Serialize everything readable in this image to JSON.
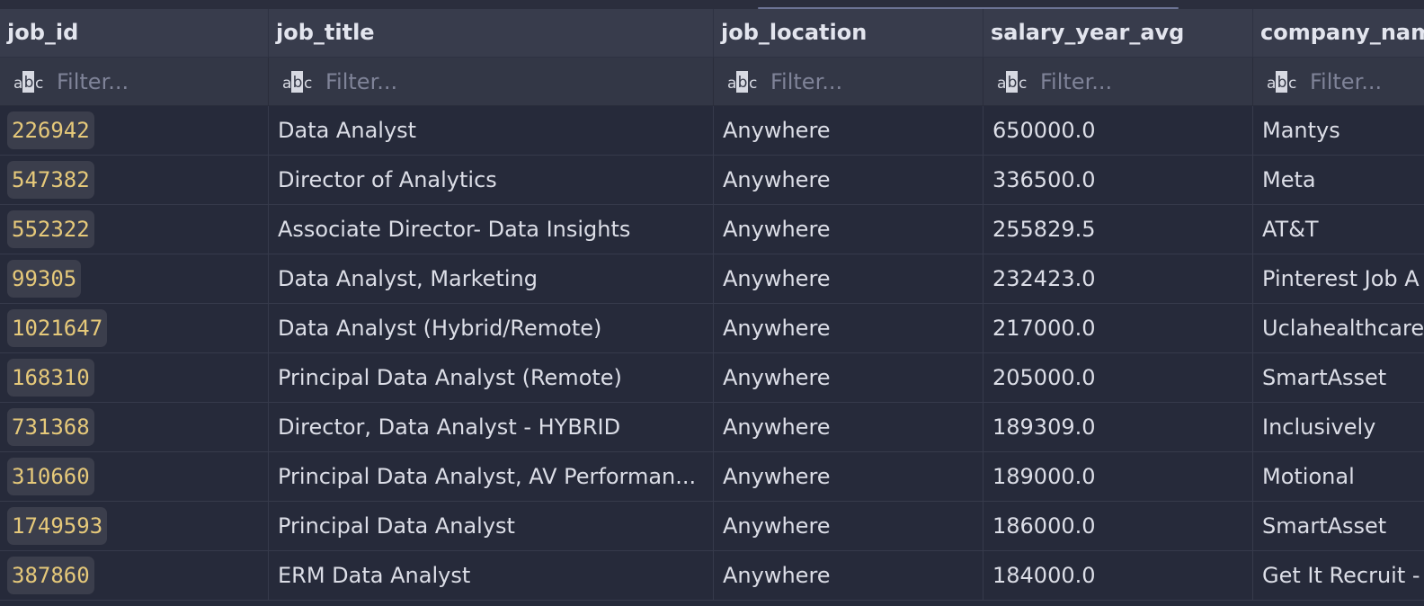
{
  "table": {
    "columns": [
      {
        "key": "job_id",
        "label": "job_id"
      },
      {
        "key": "job_title",
        "label": "job_title"
      },
      {
        "key": "job_location",
        "label": "job_location"
      },
      {
        "key": "salary_year_avg",
        "label": "salary_year_avg"
      },
      {
        "key": "company_name",
        "label": "company_nam"
      }
    ],
    "filter": {
      "placeholder": "Filter...",
      "type_icon_label": "abc"
    },
    "rows": [
      {
        "job_id": "226942",
        "job_title": "Data Analyst",
        "job_location": "Anywhere",
        "salary_year_avg": "650000.0",
        "company_name": "Mantys"
      },
      {
        "job_id": "547382",
        "job_title": "Director of Analytics",
        "job_location": "Anywhere",
        "salary_year_avg": "336500.0",
        "company_name": "Meta"
      },
      {
        "job_id": "552322",
        "job_title": "Associate Director- Data Insights",
        "job_location": "Anywhere",
        "salary_year_avg": "255829.5",
        "company_name": "AT&T"
      },
      {
        "job_id": "99305",
        "job_title": "Data Analyst, Marketing",
        "job_location": "Anywhere",
        "salary_year_avg": "232423.0",
        "company_name": "Pinterest Job A"
      },
      {
        "job_id": "1021647",
        "job_title": "Data Analyst (Hybrid/Remote)",
        "job_location": "Anywhere",
        "salary_year_avg": "217000.0",
        "company_name": "Uclahealthcare"
      },
      {
        "job_id": "168310",
        "job_title": "Principal Data Analyst (Remote)",
        "job_location": "Anywhere",
        "salary_year_avg": "205000.0",
        "company_name": "SmartAsset"
      },
      {
        "job_id": "731368",
        "job_title": "Director, Data Analyst - HYBRID",
        "job_location": "Anywhere",
        "salary_year_avg": "189309.0",
        "company_name": "Inclusively"
      },
      {
        "job_id": "310660",
        "job_title": "Principal Data Analyst, AV Performan...",
        "job_location": "Anywhere",
        "salary_year_avg": "189000.0",
        "company_name": "Motional"
      },
      {
        "job_id": "1749593",
        "job_title": "Principal Data Analyst",
        "job_location": "Anywhere",
        "salary_year_avg": "186000.0",
        "company_name": "SmartAsset"
      },
      {
        "job_id": "387860",
        "job_title": "ERM Data Analyst",
        "job_location": "Anywhere",
        "salary_year_avg": "184000.0",
        "company_name": "Get It Recruit -"
      }
    ]
  },
  "colors": {
    "background": "#262a3a",
    "header_background": "#383c4c",
    "filter_background": "#333746",
    "id_text": "#e6c97a",
    "id_chip": "#3b3e4c",
    "text": "#dcdee7"
  }
}
